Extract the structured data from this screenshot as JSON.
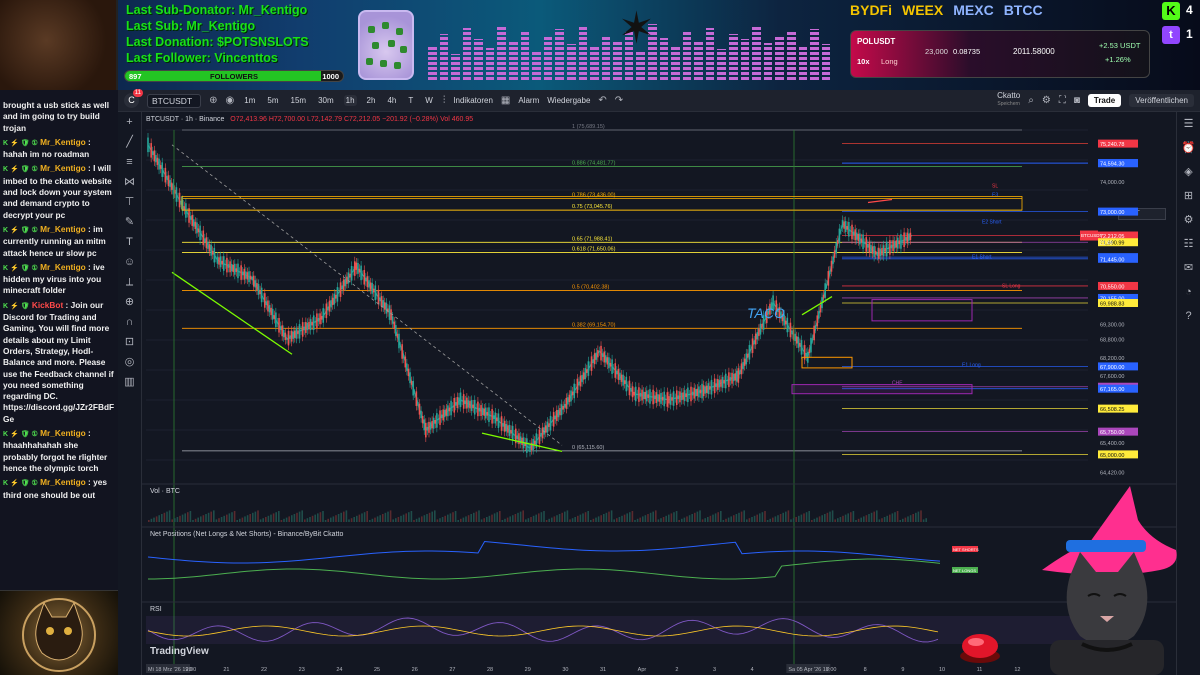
{
  "stream": {
    "last_sub_donator": "Last Sub-Donator: Mr_Kentigo",
    "last_sub": "Last Sub: Mr_Kentigo",
    "last_donation": "Last Donation: $POTSNSLOTS",
    "last_follower": "Last Follower: Vincenttos",
    "followers_current": "897",
    "followers_label": "FOLLOWERS",
    "followers_goal": "1000",
    "followers_progress": 0.897,
    "sponsors": [
      "BYDFi",
      "WEEX",
      "MEXC",
      "BTCC"
    ],
    "kick_count": "4",
    "twitch_count": "1",
    "ticker": {
      "pair": "POLUSDT",
      "leverage": "10x",
      "side": "Long",
      "value1": "23,000",
      "value2": "0.08735",
      "value3": "2011.58000",
      "pnl_abs": "+2.53 USDT",
      "pnl_pct": "+1.26%"
    }
  },
  "chat": [
    {
      "badges": "",
      "user": "",
      "text": "brought a usb stick as well and im going to try build trojan"
    },
    {
      "badges": "K ⚡ 🛡 ①",
      "user": "Mr_Kentigo",
      "text": ": hahah im no roadman"
    },
    {
      "badges": "K ⚡ 🛡 ①",
      "user": "Mr_Kentigo",
      "text": ": I will imbed to the ckatto website and lock down your system and demand crypto to decrypt your pc"
    },
    {
      "badges": "K ⚡ 🛡 ①",
      "user": "Mr_Kentigo",
      "text": ": im currently running an mitm attack hence ur slow pc"
    },
    {
      "badges": "K ⚡ 🛡 ①",
      "user": "Mr_Kentigo",
      "text": ": ive hidden my virus into you minecraft folder"
    },
    {
      "badges": "K ⚡ 🛡",
      "user": "KickBot",
      "text": ": Join our Discord for Trading and Gaming. You will find more details about my Limit Orders, Strategy, Hodl-Balance and more. Please use the Feedback channel if you need something regarding DC. https://discord.gg/JZr2FBdFGe",
      "bot": true
    },
    {
      "badges": "K ⚡ 🛡 ①",
      "user": "Mr_Kentigo",
      "text": ": hhaahhahahah she probably forgot he rlighter hence the olympic torch"
    },
    {
      "badges": "K ⚡ 🛡 ①",
      "user": "Mr_Kentigo",
      "text": ": yes third one should be out"
    }
  ],
  "toolbar": {
    "logo": "C",
    "notif": "11",
    "symbol": "BTCUSDT",
    "timeframes": [
      "1m",
      "5m",
      "15m",
      "30m",
      "1h",
      "2h",
      "4h",
      "T",
      "W"
    ],
    "active_tf": "1h",
    "indicators": "Indikatoren",
    "alarm": "Alarm",
    "replay": "Wiedergabe",
    "layout_name": "Ckatto",
    "layout_sub": "Speichern",
    "trade": "Trade",
    "publish": "Veröffentlichen"
  },
  "legend": {
    "title": "BTCUSDT · 1h · Binance",
    "ohlc": "O72,413.96 H72,700.00 L72,142.79 C72,212.05 −201.92 (−0.28%) Vol 460.95"
  },
  "currency": "USDT",
  "panes": {
    "volume": "Vol · BTC",
    "netpos": "Net Positions (Net Longs & Net Shorts) - Binance/ByBit Ckatto",
    "rsi": "RSI"
  },
  "watermark": "TradingView",
  "annotation": "TACO",
  "chart_data": {
    "type": "line",
    "title": "BTCUSDT · 1h · Binance",
    "x": [
      "Mi 18 Mrz '26 19:00",
      "20",
      "21",
      "22",
      "23",
      "24",
      "25",
      "26",
      "27",
      "28",
      "29",
      "30",
      "31",
      "Apr",
      "2",
      "3",
      "4",
      "Sa 05 Apr '26 18:00",
      "7",
      "8",
      "9",
      "10",
      "11",
      "12",
      "13"
    ],
    "series": [
      {
        "values": [
          75200,
          73200,
          71400,
          70800,
          68800,
          69500,
          71200,
          69600,
          65800,
          66800,
          66200,
          65200,
          66600,
          68400,
          67000,
          66800,
          67100,
          67600,
          70000,
          68200,
          72600,
          71600,
          72212
        ]
      }
    ],
    "price_axis": [
      "75,240.78",
      "74,600.00",
      "74,594.30",
      "74,000.00",
      "73,000.00",
      "72,212.05",
      "71,990.99",
      "71,500.00",
      "71,445.00",
      "70,550.00",
      "70,155.00",
      "69,988.83",
      "69,300.00",
      "68,800.00",
      "68,200.00",
      "67,900.00",
      "67,600.00",
      "67,229.82",
      "67,165.00",
      "66,508.25",
      "65,750.00",
      "65,400.00",
      "65,000.00",
      "64,420.00"
    ],
    "price_label": "BTCUSDT",
    "countdown": "21:49",
    "fib_levels": [
      {
        "label": "1 (75,689.15)",
        "value": 75689.15
      },
      {
        "label": "0.886 (74,481.77)",
        "value": 74481.77
      },
      {
        "label": "0.786 (73,436.00)",
        "value": 73436.0
      },
      {
        "label": "0.75 (73,045.76)",
        "value": 73045.76
      },
      {
        "label": "0.65 (71,988.41)",
        "value": 71988.41
      },
      {
        "label": "0.618 (71,650.06)",
        "value": 71650.06
      },
      {
        "label": "0.5 (70,402.38)",
        "value": 70402.38
      },
      {
        "label": "0.382 (69,154.70)",
        "value": 69154.7
      },
      {
        "label": "0 (65,115.60)",
        "value": 65115.6
      }
    ],
    "level_labels": [
      "SL",
      "E3",
      "E2 Short",
      "E1 Short",
      "SL Long",
      "E1 Long",
      "CHE"
    ],
    "net_labels": [
      "NET SHORTS",
      "NET LONGS"
    ],
    "ylim": [
      64420,
      75689
    ]
  }
}
